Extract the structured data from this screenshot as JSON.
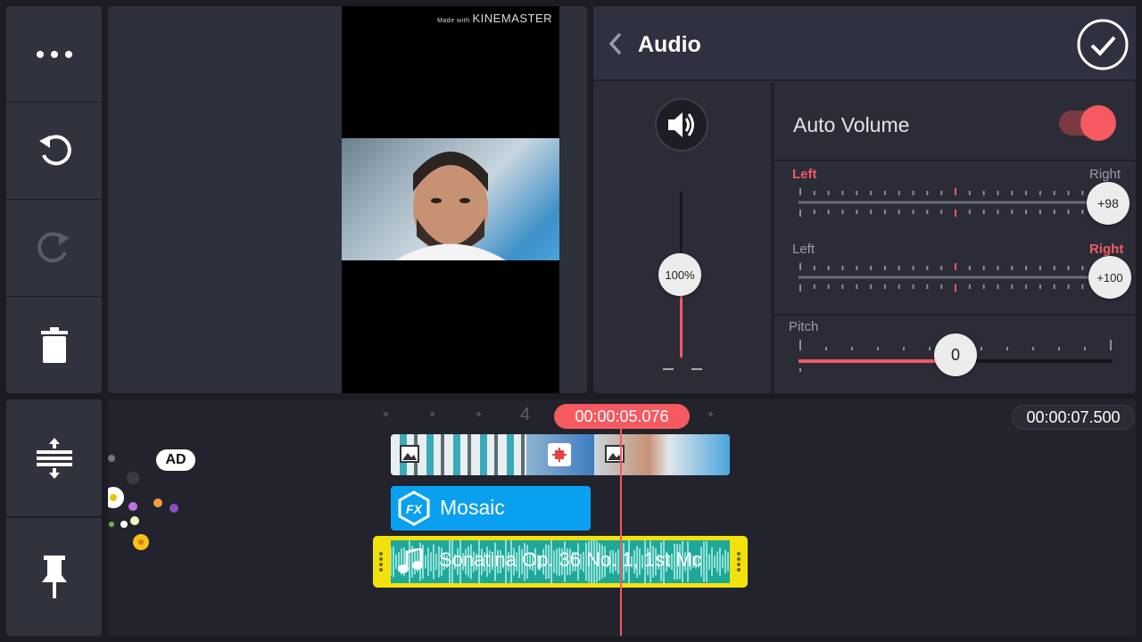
{
  "sidebar": {
    "top": [
      {
        "icon": "more-icon"
      },
      {
        "icon": "undo-icon"
      },
      {
        "icon": "redo-icon"
      },
      {
        "icon": "delete-icon"
      }
    ],
    "bottom": [
      {
        "icon": "track-height-icon"
      },
      {
        "icon": "pin-icon"
      }
    ]
  },
  "preview": {
    "watermark_prefix": "Made with",
    "watermark_brand": "KINEMASTER"
  },
  "audio_panel": {
    "title": "Audio",
    "volume_level": "100%",
    "volume_fraction": 1.0,
    "auto_volume_label": "Auto Volume",
    "auto_volume_on": true,
    "pan1": {
      "left_label": "Left",
      "right_label": "Right",
      "value": "+98",
      "active": "left"
    },
    "pan2": {
      "left_label": "Left",
      "right_label": "Right",
      "value": "+100",
      "active": "right"
    },
    "pitch": {
      "label": "Pitch",
      "value": "0",
      "fraction": 0.5
    }
  },
  "timeline": {
    "ruler_marker": "4",
    "playhead_time": "00:00:05.076",
    "total_time": "00:00:07.500",
    "ad_badge": "AD",
    "fx_label": "Mosaic",
    "audio_clip_label": "Sonatina Op. 36 No. 1, 1st Mc"
  },
  "colors": {
    "accent": "#f45a5f",
    "fx_blue": "#0aa0f0",
    "audio_teal": "#1fa79a",
    "audio_border": "#f2e10a"
  }
}
